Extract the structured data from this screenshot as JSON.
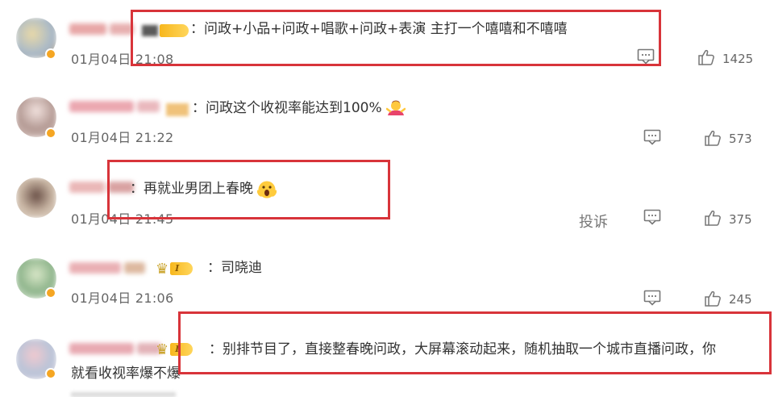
{
  "comments": [
    {
      "text": "：问政+小品+问政+唱歌+问政+表演 主打一个嘻嘻和不嘻嘻",
      "time": "01月04日 21:08",
      "likes": "1425"
    },
    {
      "text": "：问政这个收视率能达到100%",
      "time": "01月04日 21:22",
      "likes": "573"
    },
    {
      "text": "：再就业男团上春晚",
      "time": "01月04日 21:45",
      "likes": "375",
      "report_label": "投诉"
    },
    {
      "text": "：司晓迪",
      "time": "01月04日 21:06",
      "likes": "245",
      "level": "I"
    },
    {
      "text": "：别排节目了，直接整春晚问政，大屏幕滚动起来，随机抽取一个城市直播问政，你",
      "text_line2": "就看收视率爆不爆",
      "level": "I"
    }
  ],
  "icons": {
    "reply": "comment-reply-icon",
    "like": "thumbs-up-icon",
    "emoji_shrug": "person-shrug-emoji",
    "emoji_scream": "screaming-face-emoji"
  },
  "colors": {
    "highlight_box": "#d8343a",
    "meta_text": "#666666",
    "comment_text": "#333333"
  }
}
